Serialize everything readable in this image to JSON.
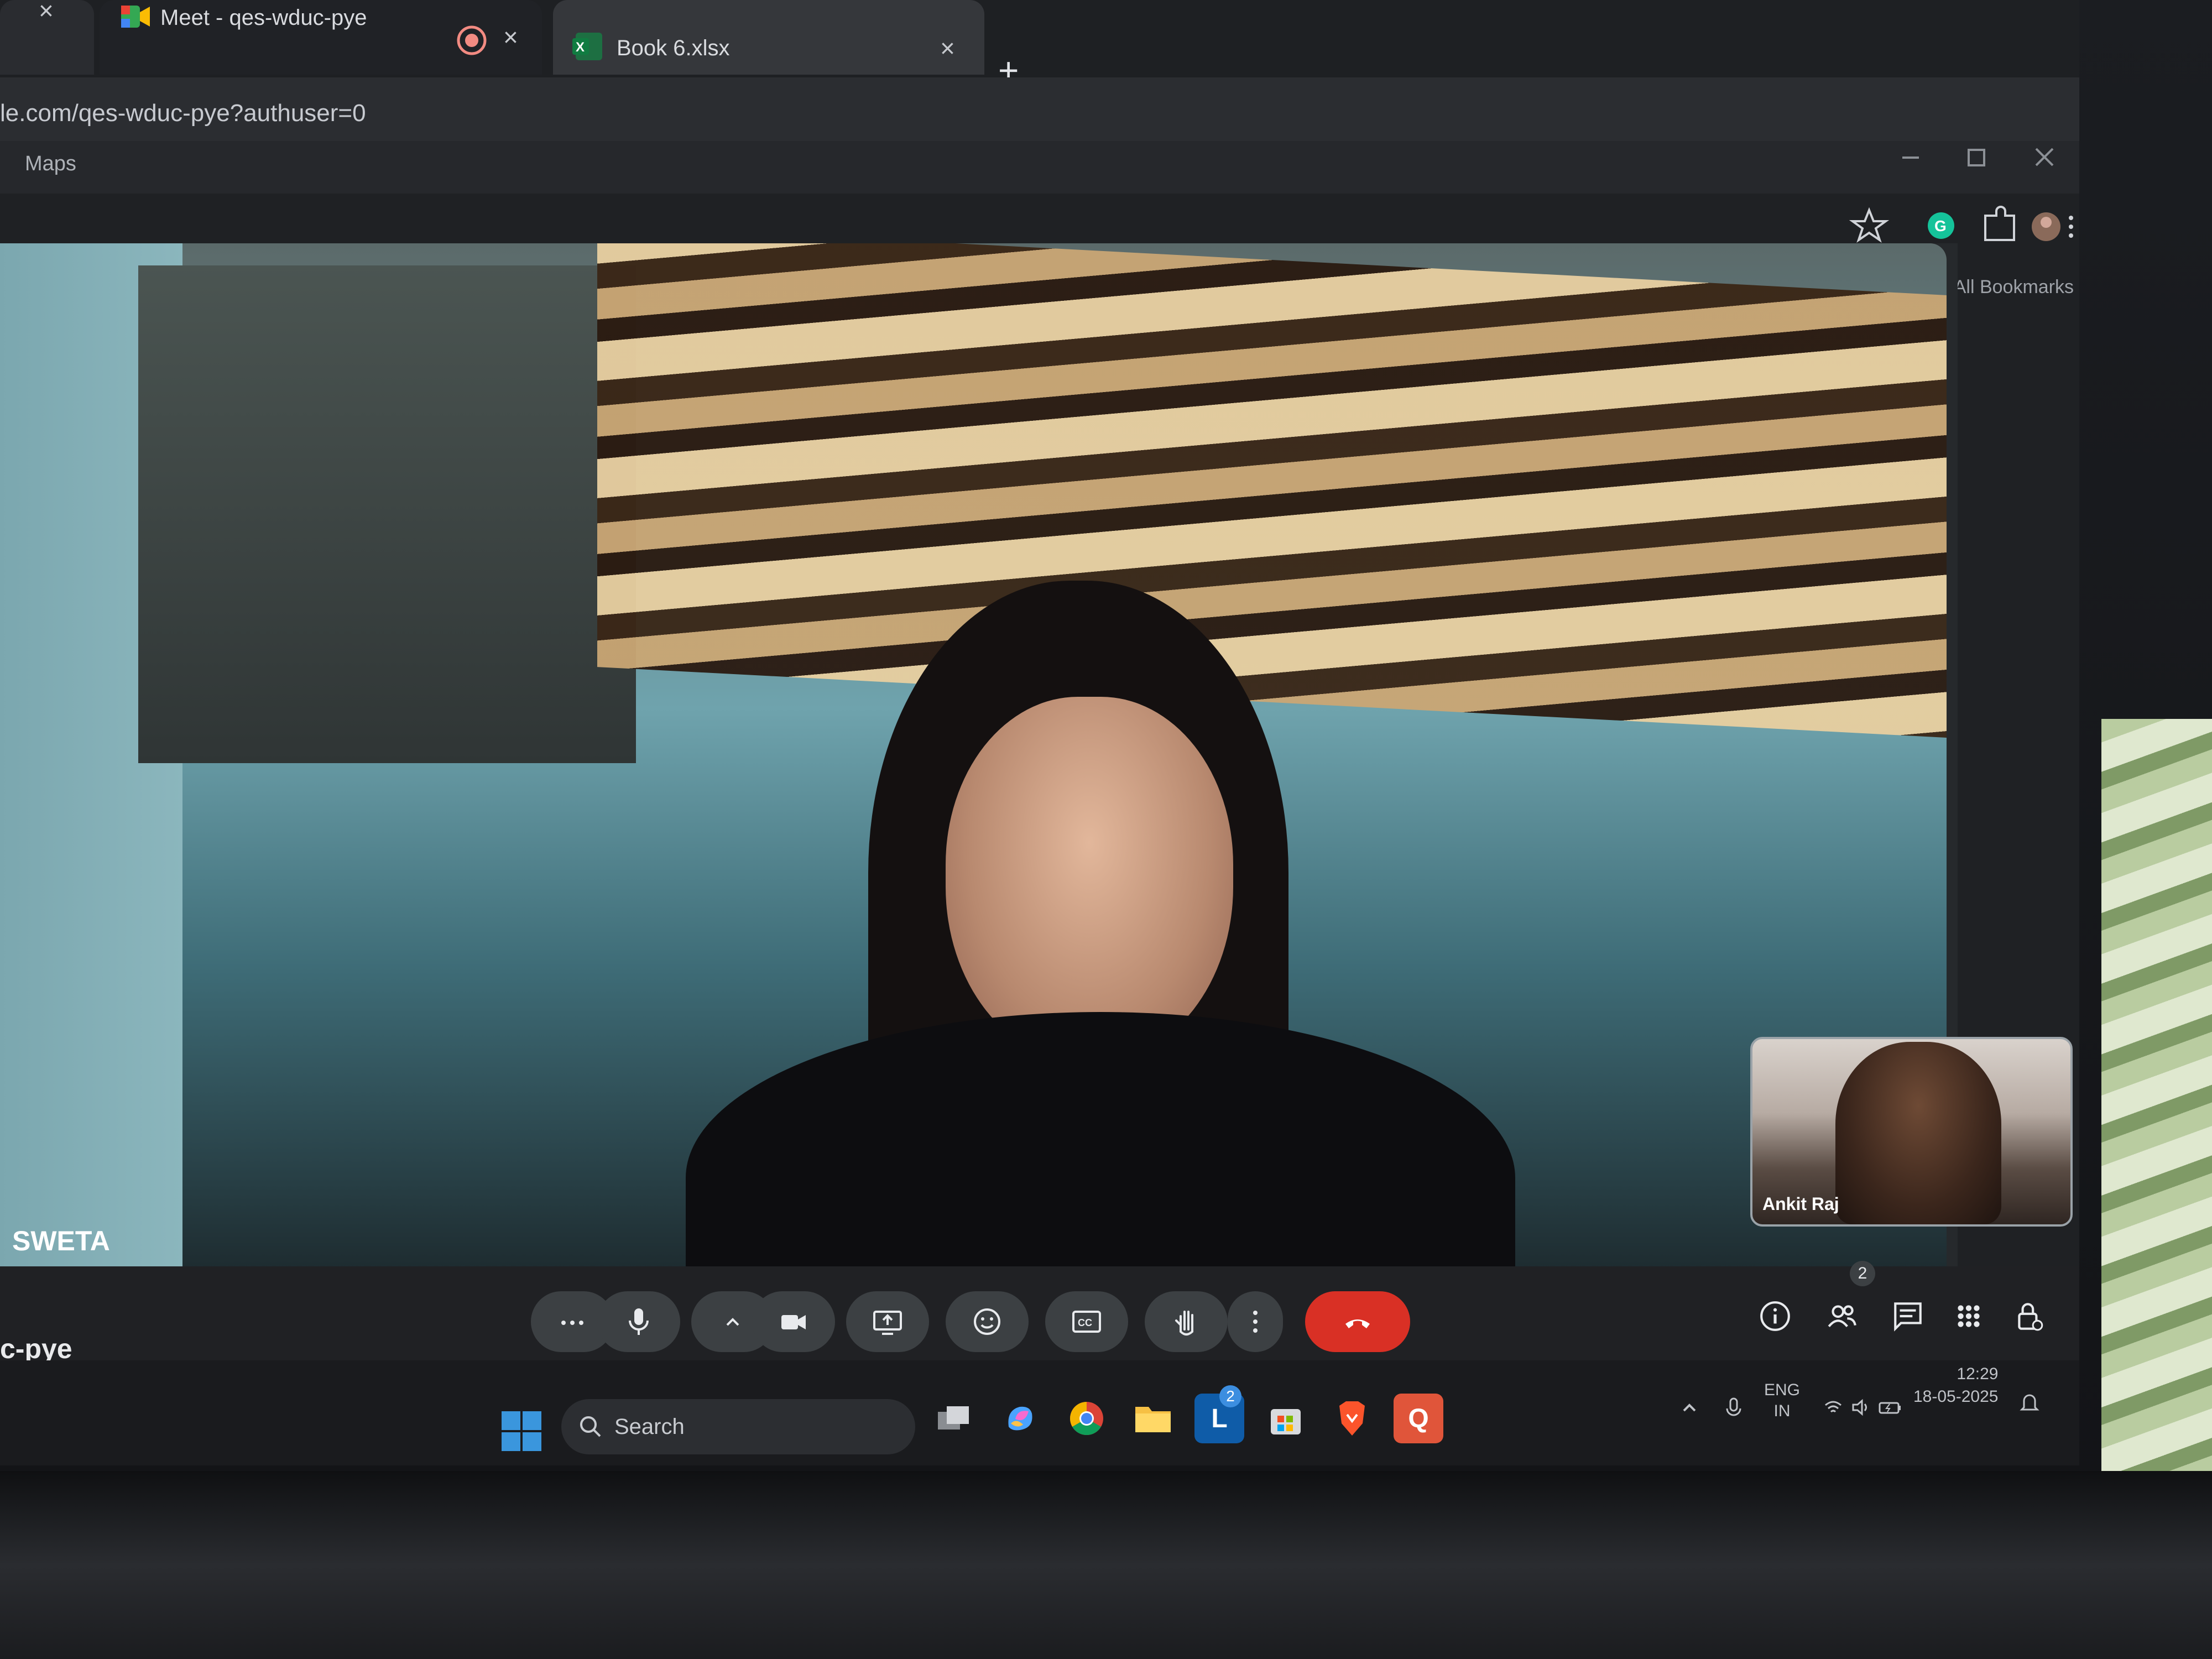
{
  "browser": {
    "tabs": [
      {
        "label": "Meet - qes-wduc-pye"
      },
      {
        "label": "Book 6.xlsx"
      }
    ],
    "new_tab_label": "+",
    "close_glyph": "×",
    "url": "le.com/qes-wduc-pye?authuser=0",
    "bookmarks": [
      {
        "label": "Maps"
      }
    ],
    "all_bookmarks_label": "All Bookmarks"
  },
  "meet": {
    "main_participant_name": "SWETA",
    "self_view_name": "Ankit Raj",
    "meeting_code": "c-pye",
    "participant_count": "2",
    "controls": {
      "more": "...",
      "icons": [
        "more-icon",
        "microphone-icon",
        "chevron-up-icon",
        "camera-icon",
        "present-icon",
        "emoji-icon",
        "captions-icon",
        "raise-hand-icon",
        "more-options-icon",
        "end-call-icon"
      ]
    },
    "side_icons": [
      "info-icon",
      "people-icon",
      "chat-icon",
      "activities-icon",
      "host-controls-icon"
    ]
  },
  "taskbar": {
    "search_label": "Search",
    "badge_count": "2",
    "language": {
      "line1": "ENG",
      "line2": "IN"
    },
    "time": "12:29",
    "date": "18-05-2025"
  },
  "colors": {
    "leave_button": "#d93025",
    "meet_bar": "#202124",
    "control_button": "#3c4043"
  }
}
